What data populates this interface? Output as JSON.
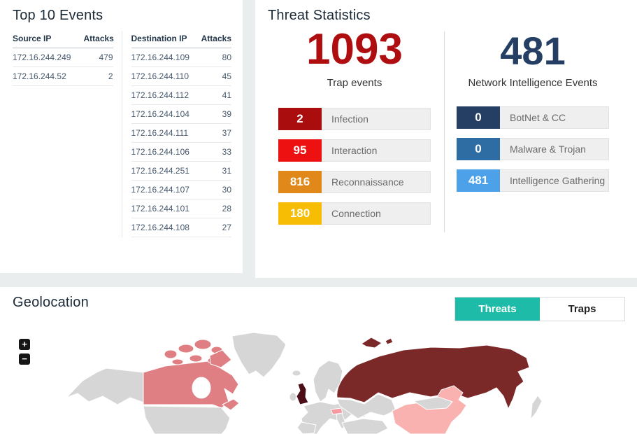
{
  "top_events": {
    "title": "Top 10 Events",
    "source_table": {
      "headers": [
        "Source IP",
        "Attacks"
      ],
      "rows": [
        {
          "ip": "172.16.244.249",
          "attacks": "479"
        },
        {
          "ip": "172.16.244.52",
          "attacks": "2"
        }
      ]
    },
    "dest_table": {
      "headers": [
        "Destination IP",
        "Attacks"
      ],
      "rows": [
        {
          "ip": "172.16.244.109",
          "attacks": "80"
        },
        {
          "ip": "172.16.244.110",
          "attacks": "45"
        },
        {
          "ip": "172.16.244.112",
          "attacks": "41"
        },
        {
          "ip": "172.16.244.104",
          "attacks": "39"
        },
        {
          "ip": "172.16.244.111",
          "attacks": "37"
        },
        {
          "ip": "172.16.244.106",
          "attacks": "33"
        },
        {
          "ip": "172.16.244.251",
          "attacks": "31"
        },
        {
          "ip": "172.16.244.107",
          "attacks": "30"
        },
        {
          "ip": "172.16.244.101",
          "attacks": "28"
        },
        {
          "ip": "172.16.244.108",
          "attacks": "27"
        }
      ]
    }
  },
  "threat_statistics": {
    "title": "Threat Statistics",
    "trap_events": {
      "value": "1093",
      "label": "Trap events",
      "value_color": "#ae0e10",
      "categories": [
        {
          "count": "2",
          "label": "Infection",
          "color": "#a90d0d"
        },
        {
          "count": "95",
          "label": "Interaction",
          "color": "#ee1111"
        },
        {
          "count": "816",
          "label": "Reconnaissance",
          "color": "#e0891a"
        },
        {
          "count": "180",
          "label": "Connection",
          "color": "#f7bd04"
        }
      ]
    },
    "network_intelligence": {
      "value": "481",
      "label": "Network Intelligence Events",
      "value_color": "#243f63",
      "categories": [
        {
          "count": "0",
          "label": "BotNet & CC",
          "color": "#243f63"
        },
        {
          "count": "0",
          "label": "Malware & Trojan",
          "color": "#2e6da4"
        },
        {
          "count": "481",
          "label": "Intelligence Gathering",
          "color": "#4da1e8"
        }
      ]
    }
  },
  "geolocation": {
    "title": "Geolocation",
    "toggle": {
      "threats_label": "Threats",
      "traps_label": "Traps",
      "active": "Threats",
      "active_color": "#1ebca8"
    },
    "zoom_in_label": "+",
    "zoom_out_label": "−",
    "map": {
      "colors": {
        "default": "#d6d6d6",
        "canada": "#df7f83",
        "russia": "#7b2828",
        "uk": "#4c0d16",
        "china": "#f9b2b0",
        "bulgaria": "#f59ba0"
      }
    }
  }
}
